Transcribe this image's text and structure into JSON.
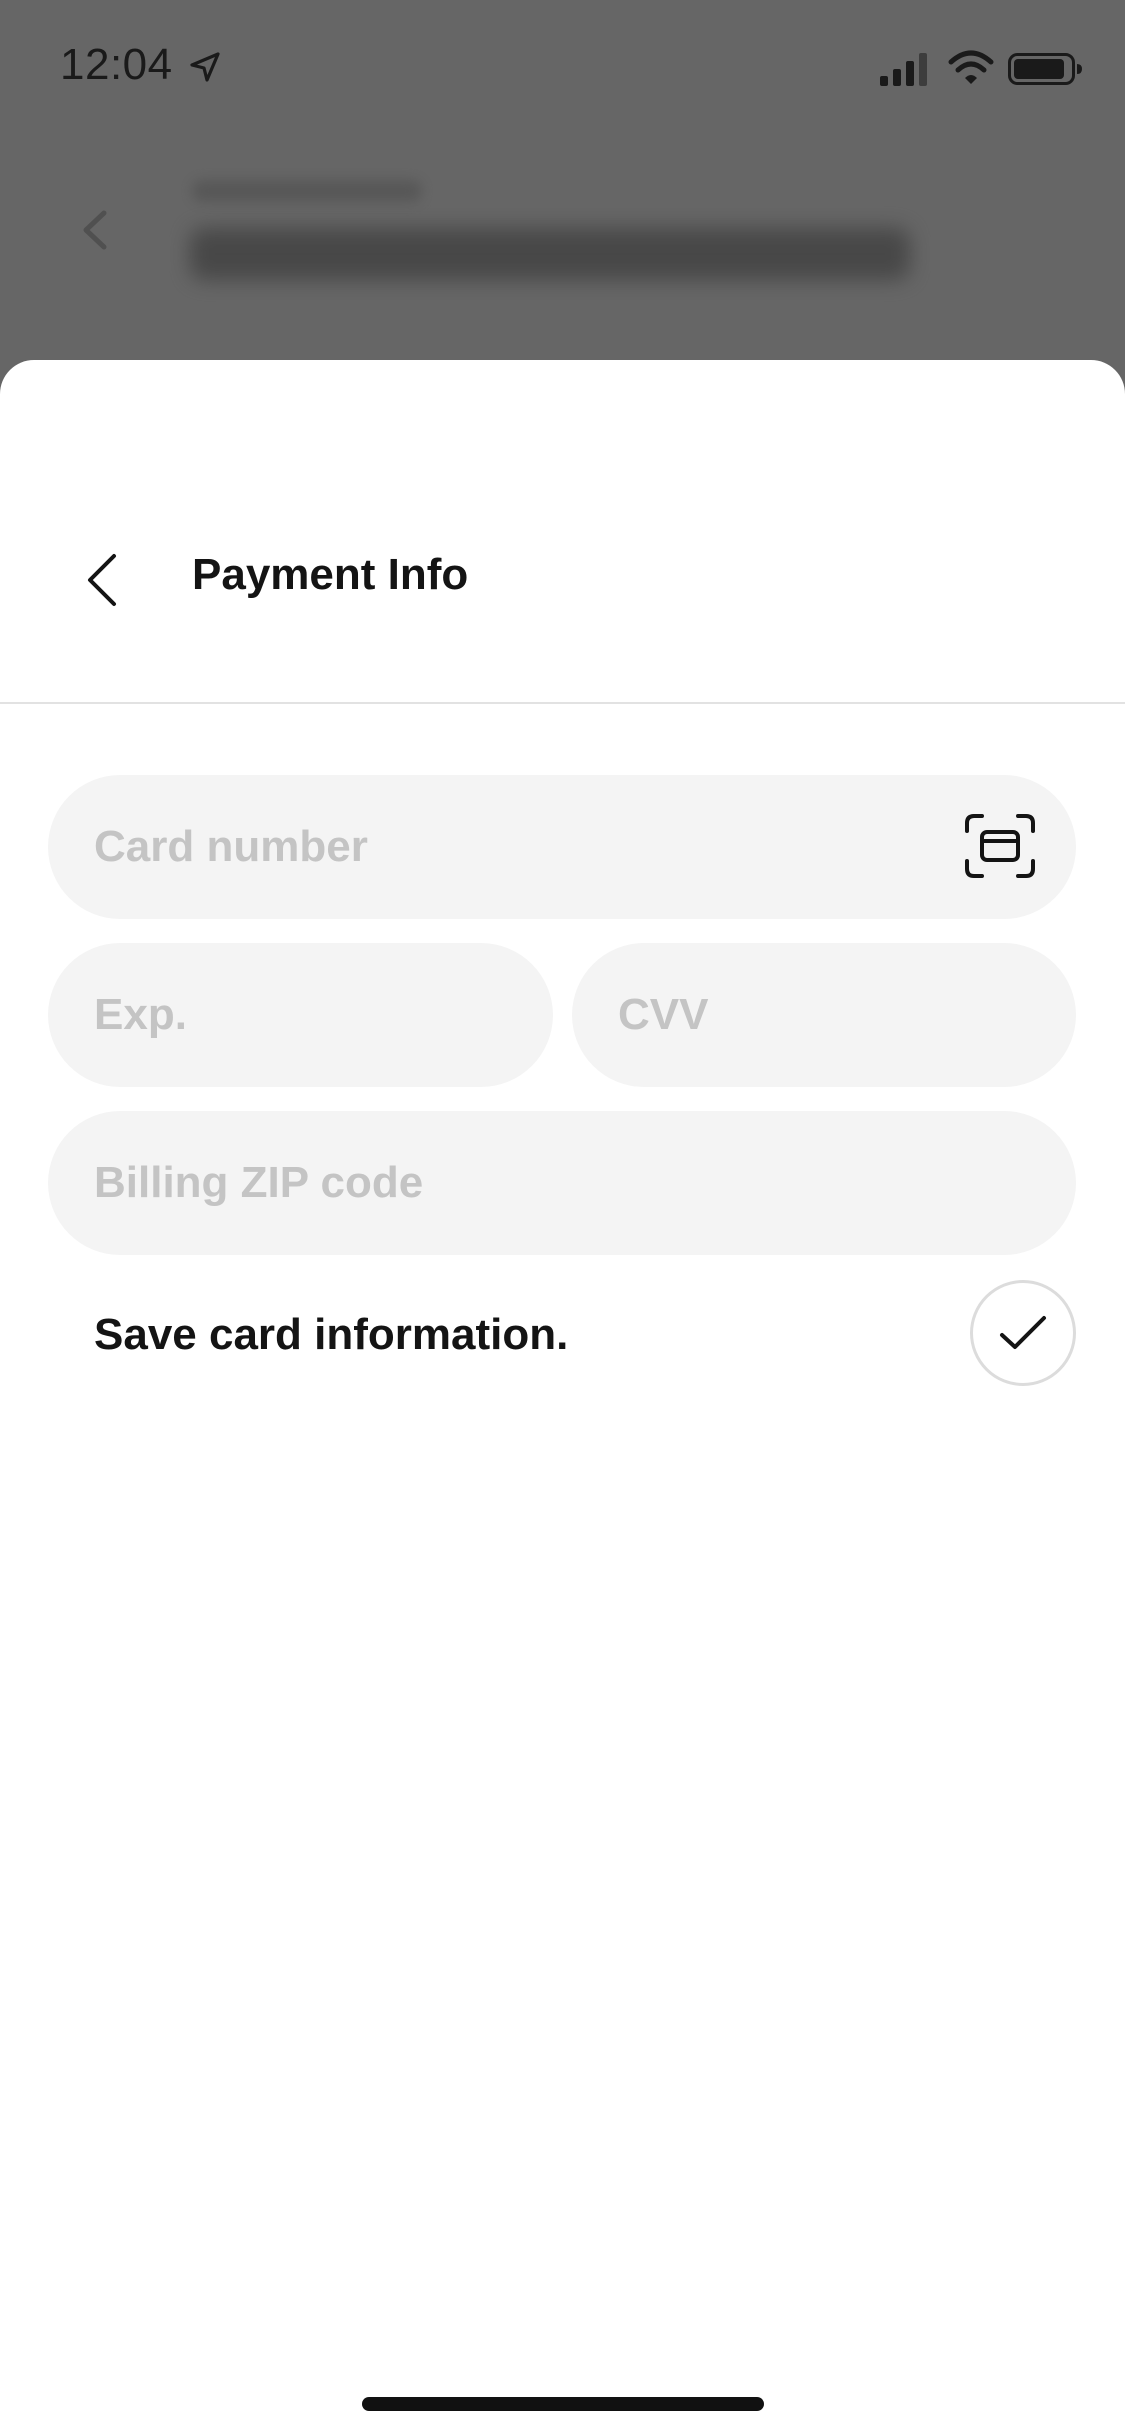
{
  "status_bar": {
    "time": "12:04",
    "icons": {
      "location": "location-arrow-icon",
      "signal": "cellular-signal-icon",
      "wifi": "wifi-icon",
      "battery": "battery-icon"
    }
  },
  "sheet": {
    "title": "Payment Info",
    "back_icon": "chevron-left-icon"
  },
  "form": {
    "card_number": {
      "placeholder": "Card number",
      "value": "",
      "scan_icon": "card-scan-icon"
    },
    "exp": {
      "placeholder": "Exp.",
      "value": ""
    },
    "cvv": {
      "placeholder": "CVV",
      "value": ""
    },
    "zip": {
      "placeholder": "Billing ZIP code",
      "value": ""
    },
    "save_card": {
      "label": "Save card information.",
      "checked": true,
      "check_icon": "checkmark-icon"
    }
  },
  "colors": {
    "overlay": "#5f5f5f",
    "sheet_background": "#ffffff",
    "field_background": "#f4f4f4",
    "placeholder_text": "#c4c4c4",
    "primary_text": "#141414",
    "divider": "#e2e2e2"
  }
}
